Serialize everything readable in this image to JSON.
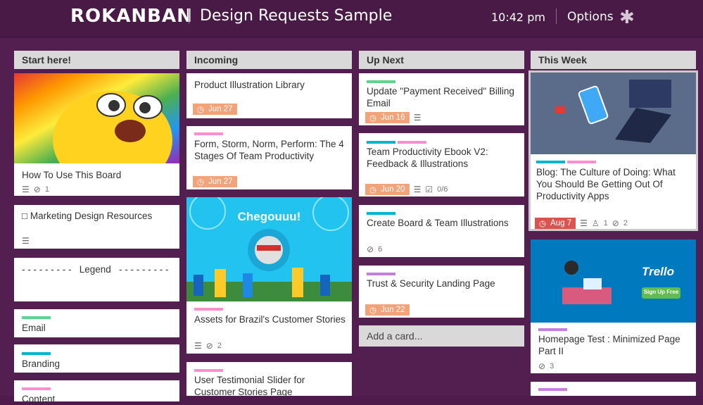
{
  "app": {
    "logo": "ROKANBAN",
    "board_title": "Design Requests Sample",
    "time": "10:42  pm",
    "options_label": "Options"
  },
  "colors": {
    "green": "#5fd38d",
    "cyan": "#00b5cc",
    "pink": "#ff8ed1",
    "purple": "#c37ee0",
    "due_orange": "#f2a37a",
    "due_red": "#d9534f",
    "topbar": "#4a1a47"
  },
  "icons": {
    "description": "description-icon",
    "attachment": "attachment-icon",
    "checklist": "checklist-icon",
    "clock": "clock-icon",
    "members": "member-icon",
    "options": "asterisk-icon"
  },
  "columns": [
    {
      "title": "Start here!",
      "cards": [
        {
          "title": "How To Use This Board",
          "image": "jake-rainbow",
          "attachments": "1"
        },
        {
          "title": "□ Marketing Design Resources"
        },
        {
          "title": "- - - - - - - - -   Legend   - - - - - - - - -"
        },
        {
          "title": "Email",
          "label": "green"
        },
        {
          "title": "Branding",
          "label": "cyan"
        },
        {
          "title": "Content",
          "label": "pink"
        }
      ]
    },
    {
      "title": "Incoming",
      "cards": [
        {
          "title": "Product Illustration Library",
          "due": "Jun  27"
        },
        {
          "title": "Form, Storm, Norm, Perform: The 4 Stages Of Team Productivity",
          "label": "pink",
          "due": "Jun  27"
        },
        {
          "title": "Assets for Brazil's Customer Stories",
          "image_text": "Chegouuu!",
          "label": "pink",
          "attachments": "2"
        },
        {
          "title": "User Testimonial Slider for Customer Stories Page",
          "label": "pink"
        }
      ]
    },
    {
      "title": "Up Next",
      "cards": [
        {
          "title": "Update \"Payment Received\" Billing Email",
          "label": "green",
          "due": "Jun  16"
        },
        {
          "title": "Team Productivity Ebook V2: Feedback & Illustrations",
          "due": "Jun  20",
          "checklist": "0/6"
        },
        {
          "title": "Create Board & Team Illustrations",
          "label": "cyan",
          "attachments": "6"
        },
        {
          "title": "Trust & Security Landing Page",
          "label": "purple",
          "due": "Jun  22"
        }
      ],
      "add_card": "Add a card..."
    },
    {
      "title": "This Week",
      "cards": [
        {
          "title": "Blog: The Culture of Doing: What You Should Be Getting Out Of Productivity Apps",
          "due": "Aug  7",
          "members": "1",
          "attachments": "2"
        },
        {
          "title": "Homepage Test : Minimized Page Part II",
          "label": "purple",
          "attachments": "3",
          "image_text": "Trello",
          "image_button": "Sign Up Free"
        }
      ]
    }
  ]
}
